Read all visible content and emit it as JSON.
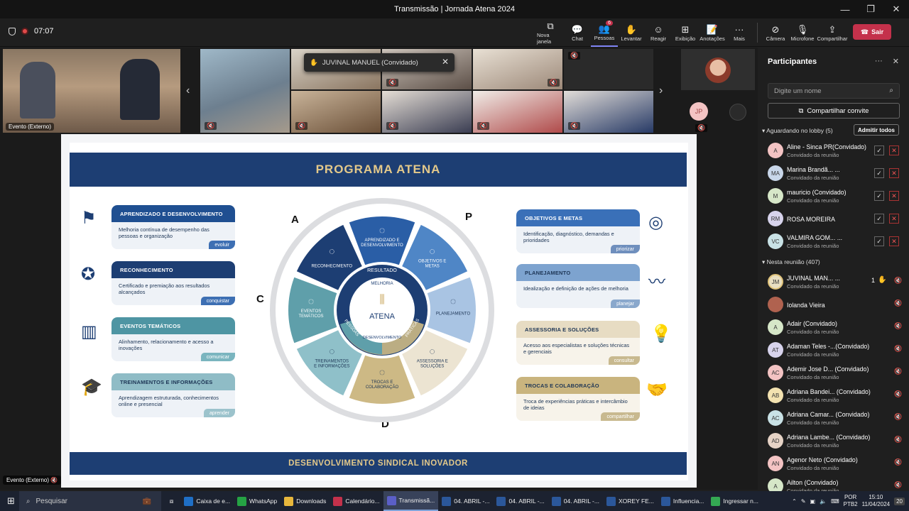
{
  "window": {
    "title": "Transmissão | Jornada Atena 2024"
  },
  "meeting": {
    "timer": "07:07"
  },
  "toolbar": {
    "items": [
      {
        "icon": "new-window-icon",
        "label": "Nova janela"
      },
      {
        "icon": "chat-icon",
        "label": "Chat"
      },
      {
        "icon": "people-icon",
        "label": "Pessoas",
        "badge": "6"
      },
      {
        "icon": "raise-hand-icon",
        "label": "Levantar"
      },
      {
        "icon": "react-icon",
        "label": "Reagir"
      },
      {
        "icon": "view-icon",
        "label": "Exibição"
      },
      {
        "icon": "notes-icon",
        "label": "Anotações"
      },
      {
        "icon": "more-icon",
        "label": "Mais"
      },
      {
        "icon": "camera-icon",
        "label": "Câmera"
      },
      {
        "icon": "mic-icon",
        "label": "Microfone"
      },
      {
        "icon": "share-icon",
        "label": "Compartilhar"
      }
    ],
    "leave_label": "Sair"
  },
  "videos": {
    "main_label": "Evento (Externo)",
    "toast_text": "JUVINAL MANUEL (Convidado)",
    "avatar_initials": "JP"
  },
  "slide": {
    "title": "PROGRAMA ATENA",
    "footer": "DESENVOLVIMENTO SINDICAL INOVADOR",
    "letters": [
      "A",
      "P",
      "C",
      "D"
    ],
    "left_cards": [
      {
        "title": "APRENDIZADO E DESENVOLVIMENTO",
        "text": "Melhoria contínua de desempenho das pessoas e organização",
        "tag": "evoluir",
        "color": "#1f4f91",
        "tagcolor": "#3d6fb3"
      },
      {
        "title": "RECONHECIMENTO",
        "text": "Certificado e premiação aos resultados alcançados",
        "tag": "conquistar",
        "color": "#1d3e73",
        "tagcolor": "#3d6fb3"
      },
      {
        "title": "EVENTOS TEMÁTICOS",
        "text": "Alinhamento, relacionamento e acesso a inovações",
        "tag": "comunicar",
        "color": "#4e95a3",
        "tagcolor": "#7ab5bf"
      },
      {
        "title": "TREINAMENTOS E INFORMAÇÕES",
        "text": "Aprendizagem estruturada, conhecimentos online e presencial",
        "tag": "aprender",
        "color": "#8fbcc6",
        "tagcolor": "#9cc3cc"
      }
    ],
    "right_cards": [
      {
        "title": "OBJETIVOS E METAS",
        "text": "Identificação, diagnóstico, demandas e prioridades",
        "tag": "priorizar",
        "color": "#3a70b8",
        "tagcolor": "#6f8fbd"
      },
      {
        "title": "PLANEJAMENTO",
        "text": "Idealização e definição de ações de melhoria",
        "tag": "planejar",
        "color": "#7da3cf",
        "tagcolor": "#8aa8cc"
      },
      {
        "title": "ASSESSORIA E SOLUÇÕES",
        "text": "Acesso aos especialistas e soluções técnicas e gerenciais",
        "tag": "consultar",
        "color": "#e7dcc3",
        "tagcolor": "#c8b98f"
      },
      {
        "title": "TROCAS E COLABORAÇÃO",
        "text": "Troca de experiências práticas e intercâmbio de ideias",
        "tag": "compartilhar",
        "color": "#c9b47e",
        "tagcolor": "#c8b98f"
      }
    ],
    "wheel": {
      "segments": [
        {
          "label": "APRENDIZADO E DESENVOLVIMENTO",
          "color": "#2a5ea6"
        },
        {
          "label": "OBJETIVOS E METAS",
          "color": "#4f86c6"
        },
        {
          "label": "PLANEJAMENTO",
          "color": "#a9c4e3"
        },
        {
          "label": "ASSESSORIA E SOLUÇÕES",
          "color": "#ece4d2"
        },
        {
          "label": "TROCAS E COLABORAÇÃO",
          "color": "#cdb985"
        },
        {
          "label": "TREINAMENTOS E INFORMAÇÕES",
          "color": "#8fc0c9"
        },
        {
          "label": "EVENTOS TEMÁTICOS",
          "color": "#5f9faa"
        },
        {
          "label": "RECONHECIMENTO",
          "color": "#1d3e73"
        }
      ],
      "inner_top": "RESULTADO",
      "inner_mid": "MELHORIA",
      "inner_left": "PESSOAS",
      "inner_right": "PRÁTICAS",
      "inner_bottom": "DESENVOLVIMENTO",
      "center": "ATENA"
    }
  },
  "panel": {
    "title": "Participantes",
    "search_placeholder": "Digite um nome",
    "invite_label": "Compartilhar convite",
    "lobby_header": "Aguardando no lobby (5)",
    "admit_all": "Admitir todos",
    "lobby": [
      {
        "initials": "A",
        "name": "Aline - Sinca PR(Convidado)",
        "sub": "Convidado da reunião",
        "color": "#f3c3c3"
      },
      {
        "initials": "MA",
        "name": "Marina Brandã...   ...",
        "sub": "Convidado da reunião",
        "color": "#c9d7ea"
      },
      {
        "initials": "M",
        "name": "mauricio (Convidado)",
        "sub": "Convidado da reunião",
        "color": "#d6e7c8"
      },
      {
        "initials": "RM",
        "name": "ROSA MOREIRA",
        "sub": "",
        "color": "#d7d3ec"
      },
      {
        "initials": "VC",
        "name": "VALMIRA GOM... ...",
        "sub": "Convidado da reunião",
        "color": "#c9e2e6"
      }
    ],
    "meeting_header": "Nesta reunião (407)",
    "members": [
      {
        "initials": "JM",
        "name": "JUVINAL MAN...   ...",
        "sub": "Convidado da reunião",
        "color": "#e9dfc2",
        "hand": "1"
      },
      {
        "initials": "",
        "name": "Iolanda Vieira",
        "sub": "",
        "color": "#b0624f"
      },
      {
        "initials": "A",
        "name": "Adair (Convidado)",
        "sub": "Convidado da reunião",
        "color": "#d6e7c8"
      },
      {
        "initials": "AT",
        "name": "Adaman Teles -...(Convidado)",
        "sub": "Convidado da reunião",
        "color": "#d7d3ec"
      },
      {
        "initials": "AC",
        "name": "Ademir Jose D...  (Convidado)",
        "sub": "Convidado da reunião",
        "color": "#f3c3c3"
      },
      {
        "initials": "AB",
        "name": "Adriana Bandei... (Convidado)",
        "sub": "Convidado da reunião",
        "color": "#f3e2b0"
      },
      {
        "initials": "AC",
        "name": "Adriana Camar... (Convidado)",
        "sub": "Convidado da reunião",
        "color": "#c9e2e6"
      },
      {
        "initials": "AD",
        "name": "Adriana Lambe... (Convidado)",
        "sub": "Convidado da reunião",
        "color": "#e6d3c6"
      },
      {
        "initials": "AN",
        "name": "Agenor Neto (Convidado)",
        "sub": "Convidado da reunião",
        "color": "#f3c3c3"
      },
      {
        "initials": "A",
        "name": "Ailton (Convidado)",
        "sub": "Convidado da reunião",
        "color": "#d6e7c8"
      }
    ]
  },
  "taskbar": {
    "search": "Pesquisar",
    "items": [
      {
        "label": "Caixa de e...",
        "color": "#1f6fc6"
      },
      {
        "label": "WhatsApp",
        "color": "#25a244"
      },
      {
        "label": "Downloads",
        "color": "#e8b73c"
      },
      {
        "label": "Calendário...",
        "color": "#c4314b"
      },
      {
        "label": "Transmissã...",
        "color": "#5b5fc7"
      },
      {
        "label": "04. ABRIL -...",
        "color": "#2b579a"
      },
      {
        "label": "04. ABRIL -...",
        "color": "#2b579a"
      },
      {
        "label": "04. ABRIL -...",
        "color": "#2b579a"
      },
      {
        "label": "XOREY FE...",
        "color": "#2b579a"
      },
      {
        "label": "Influencia...",
        "color": "#2b579a"
      },
      {
        "label": "Ingressar n...",
        "color": "#34a853"
      }
    ],
    "lang": "POR",
    "layout": "PTB2",
    "time": "15:10",
    "date": "11/04/2024",
    "notif": "20"
  }
}
